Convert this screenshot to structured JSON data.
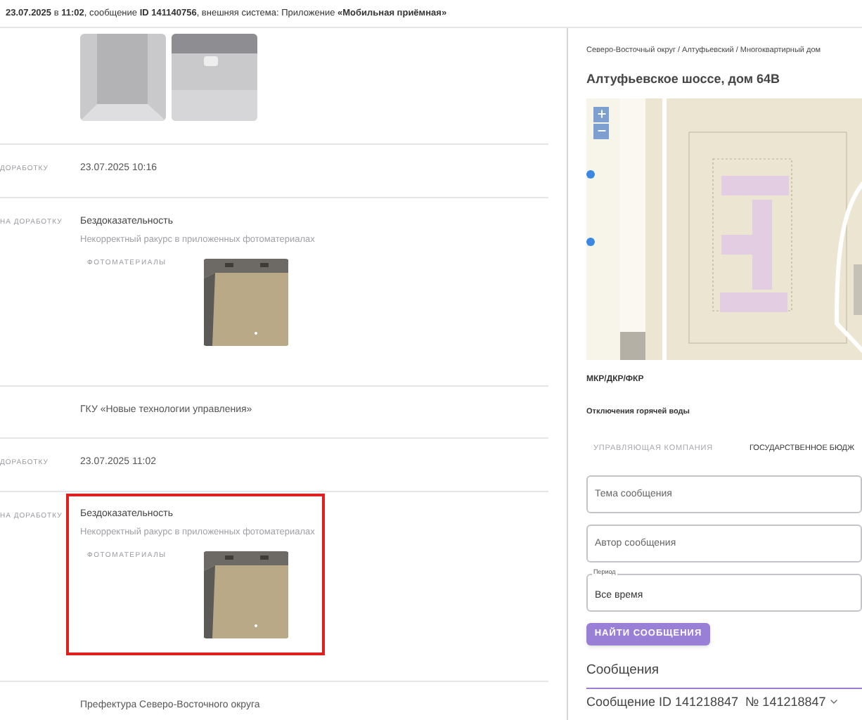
{
  "header": {
    "text": "**23.07.2025** в **11:02**, сообщение **ID 141140756**, внешняя система: Приложение **«Мобильная приёмная»**"
  },
  "rows": [
    {
      "kind": "photos",
      "photos": [
        {
          "kind": "picture"
        },
        {
          "kind": "picture"
        }
      ]
    },
    {
      "kind": "value",
      "label": "ДОРАБОТКУ",
      "value": "23.07.2025 10:16"
    },
    {
      "kind": "rejection",
      "label": "НА ДОРАБОТКУ",
      "reason": "Бездоказательность",
      "note": "Некорректный ракурс в приложенных фотоматериалах",
      "photos_label": "ФОТОМАТЕРИАЛЫ",
      "highlighted": false
    },
    {
      "kind": "value",
      "value": "ГКУ «Новые технологии управления»"
    },
    {
      "kind": "value",
      "label": "ДОРАБОТКУ",
      "value": "23.07.2025 11:02"
    },
    {
      "kind": "rejection",
      "label": "НА ДОРАБОТКУ",
      "reason": "Бездоказательность",
      "note": "Некорректный ракурс в приложенных фотоматериалах",
      "photos_label": "ФОТОМАТЕРИАЛЫ",
      "highlighted": true
    },
    {
      "kind": "value",
      "value": "Префектура Северо-Восточного округа"
    }
  ],
  "panel": {
    "breadcrumb": "Северо-Восточный округ / Алтуфьевский / Многоквартирный дом",
    "title": "Алтуфьевское шоссе, дом 64В",
    "map": {
      "kind": "picture"
    },
    "info": [
      "МКР/ДКР/ФКР",
      "Отключения горячей воды"
    ],
    "tabs": [
      {
        "label": "УПРАВЛЯЮЩАЯ КОМПАНИЯ",
        "selected": false
      },
      {
        "label": "ГОСУДАРСТВЕННОЕ БЮДЖ",
        "selected": true
      }
    ],
    "fields": [
      {
        "placeholder": "Тема сообщения"
      },
      {
        "placeholder": "Автор сообщения"
      },
      {
        "label": "Период",
        "value": "Все время"
      }
    ],
    "button": "НАЙТИ СООБЩЕНИЯ",
    "messages_title": "Сообщения",
    "message": "Сообщение ID 141218847  № 141218847"
  }
}
